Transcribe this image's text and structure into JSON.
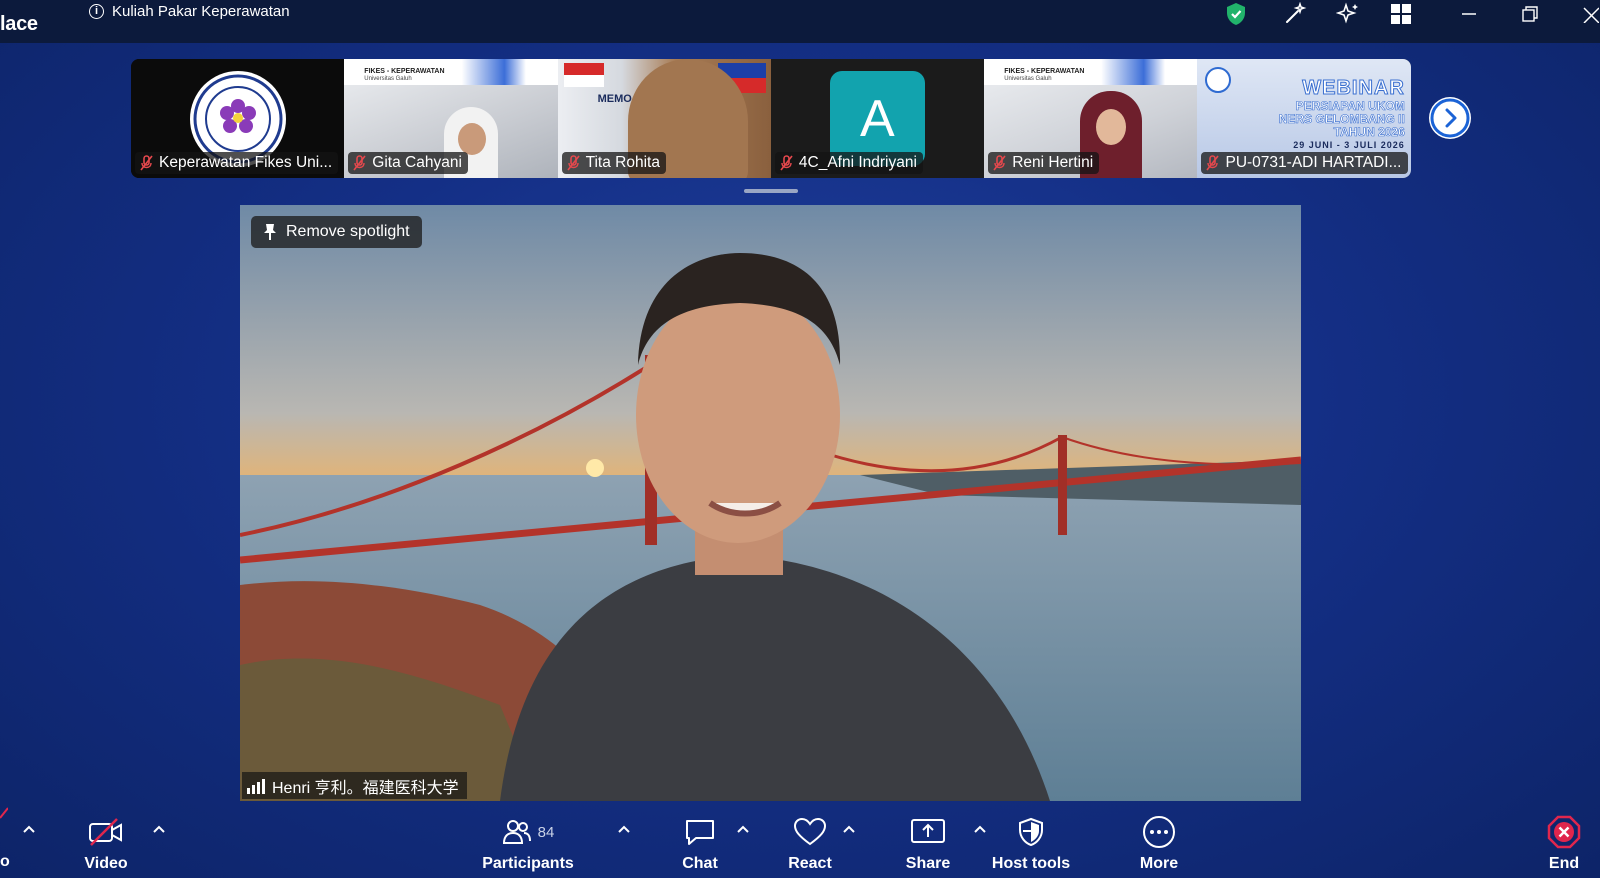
{
  "window": {
    "app_name_fragment": "lace",
    "meeting_title": "Kuliah Pakar Keperawatan",
    "info_icon": "i"
  },
  "gallery": {
    "tiles": [
      {
        "name": "Keperawatan Fikes Uni...",
        "muted": true,
        "kind": "logo",
        "bg": "#0b0b0b"
      },
      {
        "name": "Gita Cahyani",
        "muted": true,
        "kind": "video",
        "bg": "#d8dbe1"
      },
      {
        "name": "Tita Rohita",
        "muted": true,
        "kind": "video",
        "bg": "#b08a63"
      },
      {
        "name": "4C_Afni Indriyani",
        "muted": true,
        "kind": "avatar",
        "avatar_letter": "A",
        "avatar_color": "#12a3ae",
        "bg": "#1b1b1b"
      },
      {
        "name": "Reni Hertini",
        "muted": true,
        "kind": "video",
        "bg": "#dfe1e6"
      },
      {
        "name": "PU-0731-ADI HARTADI...",
        "muted": true,
        "kind": "poster",
        "bg": "#c7d3ea"
      }
    ],
    "tile2_banner": "FIKES - KEPERAWATAN",
    "tile2_banner_sub": "Universitas Galuh",
    "tile3_banner": "MEMO",
    "tile5_banner": "FIKES - KEPERAWATAN",
    "tile5_banner_sub": "Universitas Galuh",
    "poster_title": "WEBINAR",
    "poster_line1": "PERSIAPAN UKOM",
    "poster_line2": "NERS GELOMBANG II",
    "poster_line3": "TAHUN 2026",
    "poster_dates": "29 JUNI - 3 JULI 2026"
  },
  "main_video": {
    "spotlight_label": "Remove spotlight",
    "speaker_name": "Henri 亨利。福建医科大学"
  },
  "toolbar": {
    "audio_label_fragment": "o",
    "video_label": "Video",
    "participants_label": "Participants",
    "participants_count": "84",
    "chat_label": "Chat",
    "react_label": "React",
    "share_label": "Share",
    "host_tools_label": "Host tools",
    "more_label": "More",
    "end_label": "End"
  },
  "colors": {
    "accent_blue": "#1b63d6",
    "security_green": "#21b36b",
    "end_red": "#e0264d",
    "muted_red": "#e5484d"
  }
}
